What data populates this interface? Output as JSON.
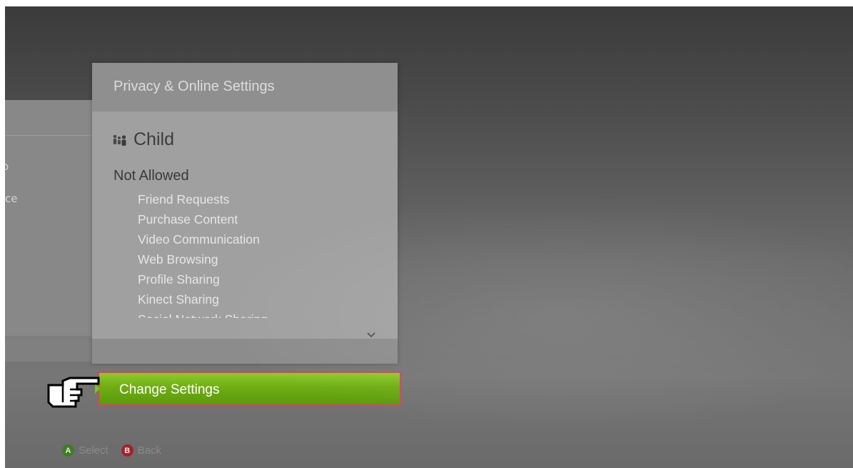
{
  "back_panel": {
    "partial_texts": [
      "o",
      "ce"
    ]
  },
  "card": {
    "title": "Privacy & Online Settings",
    "profile": {
      "icon": "family-icon",
      "name": "Child"
    },
    "section_heading": "Not Allowed",
    "items": [
      "Friend Requests",
      "Purchase Content",
      "Video Communication",
      "Web Browsing",
      "Profile Sharing",
      "Kinect Sharing",
      "Social Network Sharing"
    ],
    "scroll_icon": "chevron-down-icon"
  },
  "change_settings": {
    "label": "Change Settings",
    "accent": "#7ab51d",
    "focus_border": "#e03c6d"
  },
  "cursor": {
    "icon": "hand-pointer-icon"
  },
  "footer": {
    "select": {
      "button": "A",
      "label": "Select",
      "color": "#3f7d25"
    },
    "back": {
      "button": "B",
      "label": "Back",
      "color": "#a3222b"
    }
  }
}
